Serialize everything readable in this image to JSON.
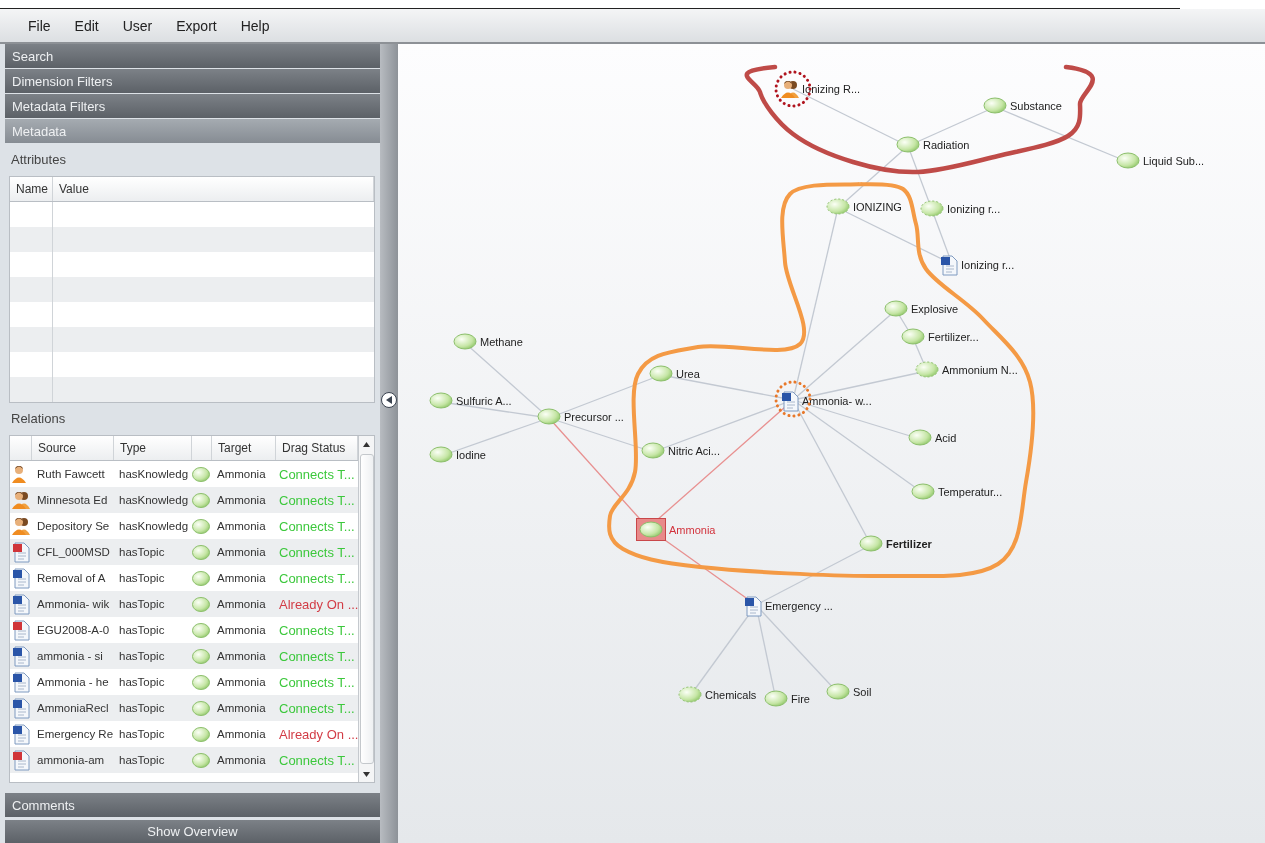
{
  "menu": [
    "File",
    "Edit",
    "User",
    "Export",
    "Help"
  ],
  "sections": [
    {
      "label": "Search",
      "selected": false
    },
    {
      "label": "Dimension Filters",
      "selected": false
    },
    {
      "label": "Metadata Filters",
      "selected": false
    },
    {
      "label": "Metadata",
      "selected": true
    }
  ],
  "attributes": {
    "title": "Attributes",
    "columns": [
      "Name",
      "Value"
    ]
  },
  "relations": {
    "title": "Relations",
    "columns": [
      "Source",
      "Type",
      "Target",
      "Drag Status"
    ],
    "rows": [
      {
        "kind": "person",
        "source": "Ruth Fawcett",
        "type": "hasKnowledg",
        "target": "Ammonia",
        "status": {
          "text": "Connects T...",
          "color": "#3cc83c"
        }
      },
      {
        "kind": "group",
        "source": "Minnesota Ed",
        "type": "hasKnowledg",
        "target": "Ammonia",
        "status": {
          "text": "Connects T...",
          "color": "#3cc83c"
        }
      },
      {
        "kind": "group",
        "source": "Depository Se",
        "type": "hasKnowledg",
        "target": "Ammonia",
        "status": {
          "text": "Connects T...",
          "color": "#3cc83c"
        }
      },
      {
        "kind": "pdf",
        "source": "CFL_000MSD",
        "type": "hasTopic",
        "target": "Ammonia",
        "status": {
          "text": "Connects T...",
          "color": "#3cc83c"
        }
      },
      {
        "kind": "word",
        "source": "Removal of A",
        "type": "hasTopic",
        "target": "Ammonia",
        "status": {
          "text": "Connects T...",
          "color": "#3cc83c"
        }
      },
      {
        "kind": "word",
        "source": "Ammonia- wik",
        "type": "hasTopic",
        "target": "Ammonia",
        "status": {
          "text": "Already On ...",
          "color": "#d23c46"
        }
      },
      {
        "kind": "pdf",
        "source": "EGU2008-A-0",
        "type": "hasTopic",
        "target": "Ammonia",
        "status": {
          "text": "Connects T...",
          "color": "#3cc83c"
        }
      },
      {
        "kind": "word",
        "source": "ammonia - si",
        "type": "hasTopic",
        "target": "Ammonia",
        "status": {
          "text": "Connects T...",
          "color": "#3cc83c"
        }
      },
      {
        "kind": "word",
        "source": "Ammonia - he",
        "type": "hasTopic",
        "target": "Ammonia",
        "status": {
          "text": "Connects T...",
          "color": "#3cc83c"
        }
      },
      {
        "kind": "word",
        "source": "AmmoniaRecl",
        "type": "hasTopic",
        "target": "Ammonia",
        "status": {
          "text": "Connects T...",
          "color": "#3cc83c"
        }
      },
      {
        "kind": "word",
        "source": "Emergency Re",
        "type": "hasTopic",
        "target": "Ammonia",
        "status": {
          "text": "Already On ...",
          "color": "#d23c46"
        }
      },
      {
        "kind": "pdf",
        "source": "ammonia-am",
        "type": "hasTopic",
        "target": "Ammonia",
        "status": {
          "text": "Connects T...",
          "color": "#3cc83c"
        }
      }
    ]
  },
  "comments": {
    "label": "Comments"
  },
  "overview_button": "Show Overview",
  "graph": {
    "nodes": [
      {
        "label": "Ionizing R...",
        "kind": "person",
        "selected": false,
        "bold": false
      },
      {
        "label": "Substance",
        "kind": "topic",
        "selected": false,
        "bold": false
      },
      {
        "label": "Radiation",
        "kind": "topic",
        "selected": false,
        "bold": false
      },
      {
        "label": "Liquid Sub...",
        "kind": "topic",
        "selected": false,
        "bold": false
      },
      {
        "label": "IONIZING",
        "kind": "tentative",
        "selected": false,
        "bold": false
      },
      {
        "label": "Ionizing r...",
        "kind": "tentative",
        "selected": false,
        "bold": false
      },
      {
        "label": "Ionizing r...",
        "kind": "document",
        "selected": false,
        "bold": false
      },
      {
        "label": "Explosive",
        "kind": "topic",
        "selected": false,
        "bold": false
      },
      {
        "label": "Fertilizer...",
        "kind": "topic",
        "selected": false,
        "bold": false
      },
      {
        "label": "Ammonium N...",
        "kind": "tentative",
        "selected": false,
        "bold": false
      },
      {
        "label": "Methane",
        "kind": "topic",
        "selected": false,
        "bold": false
      },
      {
        "label": "Sulfuric A...",
        "kind": "topic",
        "selected": false,
        "bold": false
      },
      {
        "label": "Precursor ...",
        "kind": "topic",
        "selected": false,
        "bold": false
      },
      {
        "label": "Iodine",
        "kind": "topic",
        "selected": false,
        "bold": false
      },
      {
        "label": "Urea",
        "kind": "topic",
        "selected": false,
        "bold": false
      },
      {
        "label": "Ammonia- w...",
        "kind": "document",
        "selected": false,
        "bold": false
      },
      {
        "label": "Nitric Aci...",
        "kind": "topic",
        "selected": false,
        "bold": false
      },
      {
        "label": "Acid",
        "kind": "topic",
        "selected": false,
        "bold": false
      },
      {
        "label": "Temperatur...",
        "kind": "topic",
        "selected": false,
        "bold": false
      },
      {
        "label": "Ammonia",
        "kind": "topic",
        "selected": true,
        "bold": false
      },
      {
        "label": "Fertilizer",
        "kind": "topic",
        "selected": false,
        "bold": true
      },
      {
        "label": "Emergency ...",
        "kind": "document",
        "selected": false,
        "bold": false
      },
      {
        "label": "Chemicals",
        "kind": "tentative",
        "selected": false,
        "bold": false
      },
      {
        "label": "Fire",
        "kind": "topic",
        "selected": false,
        "bold": false
      },
      {
        "label": "Soil",
        "kind": "topic",
        "selected": false,
        "bold": false
      }
    ]
  }
}
